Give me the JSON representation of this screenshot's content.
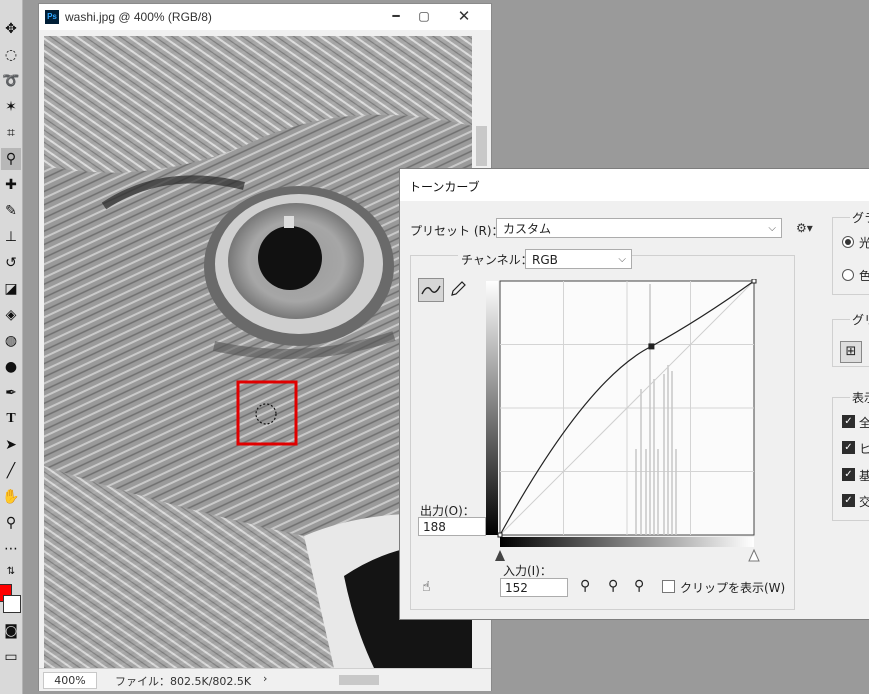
{
  "document": {
    "title": "washi.jpg @ 400% (RGB/8)",
    "ps_badge": "Ps",
    "zoom": "400%",
    "file_info": "ファイル：802.5K/802.5K",
    "status_arrow": "›"
  },
  "curves_dialog": {
    "title": "トーンカーブ",
    "preset_label": "プリセット (R)：",
    "preset_value": "カスタム",
    "channel_label": "チャンネル：",
    "channel_value": "RGB",
    "output_label": "出力(O)：",
    "output_value": "188",
    "input_label": "入力(I)：",
    "input_value": "152",
    "clip_label": "クリップを表示(W)",
    "right_panel": {
      "group1_title": "グラ",
      "radio1": "光",
      "radio2": "色",
      "group2_title": "グリ",
      "group3_title": "表示",
      "check1": "全",
      "check2": "ヒ",
      "check3": "基",
      "check4": "交"
    },
    "curve_point": {
      "input": 152,
      "output": 188
    }
  },
  "colors": {
    "foreground": "#ff0000",
    "background": "#ffffff",
    "highlight_box": "#e00000"
  }
}
